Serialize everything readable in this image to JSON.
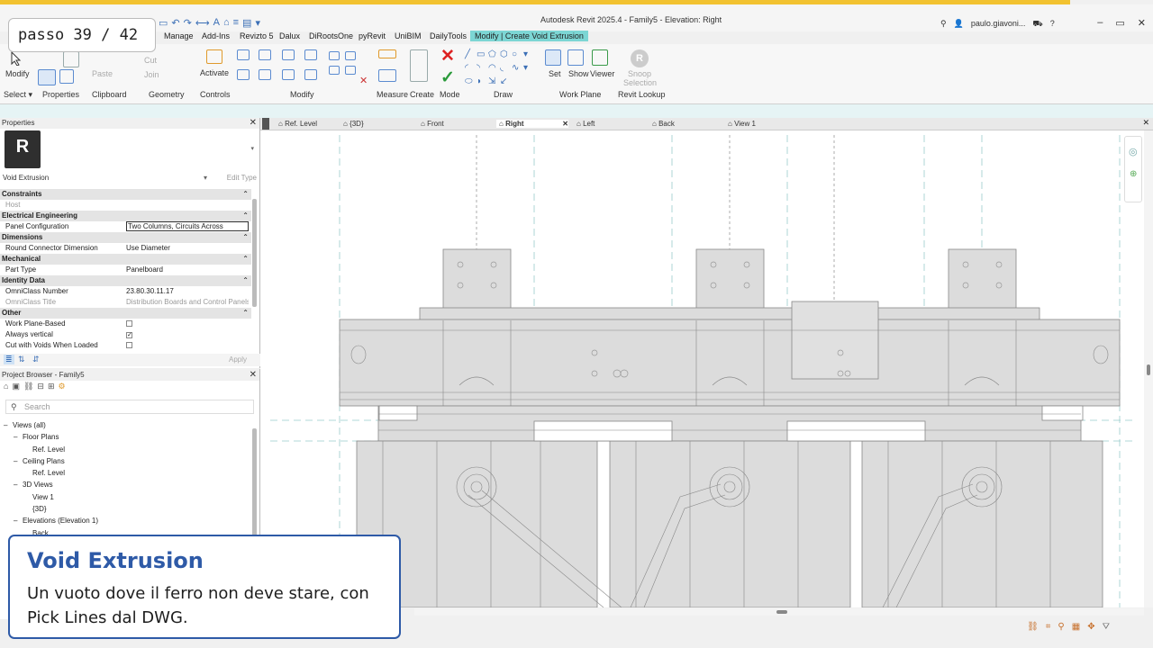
{
  "window": {
    "title": "Autodesk Revit 2025.4 - Family5 - Elevation: Right",
    "user": "paulo.giavoni...",
    "controls": [
      "–",
      "▭",
      "✕"
    ]
  },
  "step_badge": "passo 39 / 42",
  "ribbon": {
    "tabs": [
      "Manage",
      "Add-Ins",
      "Revizto 5",
      "Dalux",
      "DiRootsOne",
      "pyRevit",
      "UniBIM",
      "DailyTools"
    ],
    "context_tab": "Modify | Create Void Extrusion",
    "buttons": {
      "modify": "Modify",
      "paste": "Paste",
      "cut": "Cut",
      "join": "Join",
      "activate": "Activate",
      "set": "Set",
      "show": "Show",
      "viewer": "Viewer",
      "snoop": "Snoop",
      "selection": "Selection"
    },
    "groups": [
      "Select",
      "Properties",
      "Clipboard",
      "Geometry",
      "Controls",
      "Modify",
      "Measure",
      "Create",
      "Mode",
      "Draw",
      "Work Plane",
      "Revit Lookup"
    ]
  },
  "properties": {
    "header": "Properties",
    "type_name": "Void Extrusion",
    "edit_type": "Edit Type",
    "rows": [
      {
        "kind": "group",
        "label": "Constraints"
      },
      {
        "kind": "dim",
        "key": "Host",
        "value": ""
      },
      {
        "kind": "group",
        "label": "Electrical Engineering"
      },
      {
        "kind": "boxed",
        "key": "Panel Configuration",
        "value": "Two Columns, Circuits Across"
      },
      {
        "kind": "group",
        "label": "Dimensions"
      },
      {
        "kind": "row",
        "key": "Round Connector Dimension",
        "value": "Use Diameter"
      },
      {
        "kind": "group",
        "label": "Mechanical"
      },
      {
        "kind": "row",
        "key": "Part Type",
        "value": "Panelboard"
      },
      {
        "kind": "group",
        "label": "Identity Data"
      },
      {
        "kind": "row",
        "key": "OmniClass Number",
        "value": "23.80.30.11.17"
      },
      {
        "kind": "dim",
        "key": "OmniClass Title",
        "value": "Distribution Boards and Control Panels"
      },
      {
        "kind": "group",
        "label": "Other"
      },
      {
        "kind": "check",
        "key": "Work Plane-Based",
        "value": ""
      },
      {
        "kind": "check",
        "key": "Always vertical",
        "value": "✓"
      },
      {
        "kind": "check",
        "key": "Cut with Voids When Loaded",
        "value": ""
      }
    ],
    "apply": "Apply"
  },
  "browser": {
    "header": "Project Browser - Family5",
    "search_placeholder": "Search",
    "items": [
      {
        "label": "Views (all)",
        "indent": 1,
        "tog": "–"
      },
      {
        "label": "Floor Plans",
        "indent": 2,
        "tog": "–"
      },
      {
        "label": "Ref. Level",
        "indent": 3,
        "tog": ""
      },
      {
        "label": "Ceiling Plans",
        "indent": 2,
        "tog": "–"
      },
      {
        "label": "Ref. Level",
        "indent": 3,
        "tog": ""
      },
      {
        "label": "3D Views",
        "indent": 2,
        "tog": "–"
      },
      {
        "label": "View 1",
        "indent": 3,
        "tog": ""
      },
      {
        "label": "{3D}",
        "indent": 3,
        "tog": ""
      },
      {
        "label": "Elevations (Elevation 1)",
        "indent": 2,
        "tog": "–"
      },
      {
        "label": "Back",
        "indent": 3,
        "tog": ""
      }
    ]
  },
  "view_tabs": [
    "Ref. Level",
    "{3D}",
    "Front",
    "Right",
    "Left",
    "Back",
    "View 1"
  ],
  "active_view": "Right",
  "callout": {
    "title": "Void Extrusion",
    "body": "Un vuoto dove il ferro non deve stare, con Pick Lines dal DWG."
  }
}
